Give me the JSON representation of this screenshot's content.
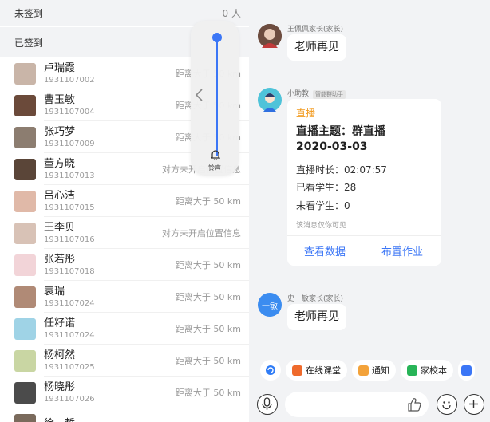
{
  "left": {
    "unsigned_label": "未签到",
    "unsigned_count": "0 人",
    "signed_label": "已签到",
    "students": [
      {
        "name": "卢瑞霞",
        "id": "1931107002",
        "distance": "距离大于 50 km",
        "avatar_color": "#c9b5a8"
      },
      {
        "name": "曹玉敏",
        "id": "1931107004",
        "distance": "距离大于 50 km",
        "avatar_color": "#6b4a3a"
      },
      {
        "name": "张巧梦",
        "id": "1931107009",
        "distance": "距离大于 50 km",
        "avatar_color": "#8c7d70"
      },
      {
        "name": "董方晓",
        "id": "1931107013",
        "distance": "对方未开启位置信息",
        "avatar_color": "#5a4538"
      },
      {
        "name": "吕心洁",
        "id": "1931107015",
        "distance": "距离大于 50 km",
        "avatar_color": "#e0b9a8"
      },
      {
        "name": "王李贝",
        "id": "1931107016",
        "distance": "对方未开启位置信息",
        "avatar_color": "#d8c2b6"
      },
      {
        "name": "张若彤",
        "id": "1931107018",
        "distance": "距离大于 50 km",
        "avatar_color": "#f2d4d8"
      },
      {
        "name": "袁瑞",
        "id": "1931107024",
        "distance": "距离大于 50 km",
        "avatar_color": "#b08a76"
      },
      {
        "name": "任籽诺",
        "id": "1931107024",
        "distance": "距离大于 50 km",
        "avatar_color": "#9fd3e6"
      },
      {
        "name": "杨柯然",
        "id": "1931107025",
        "distance": "距离大于 50 km",
        "avatar_color": "#c9d6a3"
      },
      {
        "name": "杨晓彤",
        "id": "1931107026",
        "distance": "距离大于 50 km",
        "avatar_color": "#4b4b4b"
      },
      {
        "name": "徐一哲",
        "id": "",
        "distance": "",
        "avatar_color": "#7a6a5c"
      }
    ],
    "volume": {
      "label": "铃声",
      "level": 1.0
    }
  },
  "chat": {
    "messages": [
      {
        "sender": "王佩佩家长(家长)",
        "text": "老师再见"
      },
      {
        "sender": "小助教",
        "badge": "智能群助手",
        "card": {
          "tag": "直播",
          "title_line1": "直播主题：群直播",
          "title_line2": "2020-03-03",
          "duration": "直播时长：02:07:57",
          "watched": "已看学生：28",
          "not_watched": "未看学生：0",
          "note": "该消息仅你可见",
          "btn_data": "查看数据",
          "btn_homework": "布置作业"
        }
      },
      {
        "sender": "史一敏家长(家长)",
        "avatar_text": "一敏",
        "text": "老师再见"
      }
    ],
    "quick_actions": [
      "在线课堂",
      "通知",
      "家校本"
    ],
    "colors": {
      "accent": "#3b76f6",
      "live_tag": "#f29a1e"
    }
  }
}
